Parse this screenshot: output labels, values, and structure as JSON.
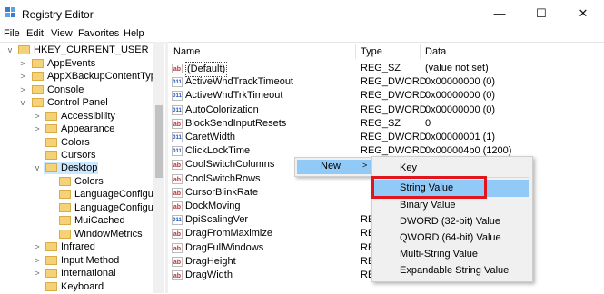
{
  "window": {
    "title": "Registry Editor",
    "minimize": "—",
    "maximize": "☐",
    "close": "✕"
  },
  "menu": [
    "File",
    "Edit",
    "View",
    "Favorites",
    "Help"
  ],
  "tree": [
    {
      "label": "HKEY_CURRENT_USER",
      "expander": "v"
    },
    {
      "label": "AppEvents",
      "expander": ">"
    },
    {
      "label": "AppXBackupContentType",
      "expander": ">"
    },
    {
      "label": "Console",
      "expander": ">"
    },
    {
      "label": "Control Panel",
      "expander": "v"
    },
    {
      "label": "Accessibility",
      "expander": ">"
    },
    {
      "label": "Appearance",
      "expander": ">"
    },
    {
      "label": "Colors",
      "expander": ""
    },
    {
      "label": "Cursors",
      "expander": ""
    },
    {
      "label": "Desktop",
      "expander": "v"
    },
    {
      "label": "Colors",
      "expander": ""
    },
    {
      "label": "LanguageConfigura",
      "expander": ""
    },
    {
      "label": "LanguageConfigura",
      "expander": ""
    },
    {
      "label": "MuiCached",
      "expander": ""
    },
    {
      "label": "WindowMetrics",
      "expander": ""
    },
    {
      "label": "Infrared",
      "expander": ">"
    },
    {
      "label": "Input Method",
      "expander": ">"
    },
    {
      "label": "International",
      "expander": ">"
    },
    {
      "label": "Keyboard",
      "expander": ""
    }
  ],
  "columns": {
    "name": "Name",
    "type": "Type",
    "data": "Data"
  },
  "rows": [
    {
      "icon": "ab",
      "name": "(Default)",
      "type": "REG_SZ",
      "data": "(value not set)"
    },
    {
      "icon": "bin",
      "name": "ActiveWndTrackTimeout",
      "type": "REG_DWORD",
      "data": "0x00000000 (0)"
    },
    {
      "icon": "bin",
      "name": "ActiveWndTrkTimeout",
      "type": "REG_DWORD",
      "data": "0x00000000 (0)"
    },
    {
      "icon": "bin",
      "name": "AutoColorization",
      "type": "REG_DWORD",
      "data": "0x00000000 (0)"
    },
    {
      "icon": "ab",
      "name": "BlockSendInputResets",
      "type": "REG_SZ",
      "data": "0"
    },
    {
      "icon": "bin",
      "name": "CaretWidth",
      "type": "REG_DWORD",
      "data": "0x00000001 (1)"
    },
    {
      "icon": "bin",
      "name": "ClickLockTime",
      "type": "REG_DWORD",
      "data": "0x000004b0 (1200)"
    },
    {
      "icon": "ab",
      "name": "CoolSwitchColumns",
      "type": "",
      "data": ""
    },
    {
      "icon": "ab",
      "name": "CoolSwitchRows",
      "type": "",
      "data": ""
    },
    {
      "icon": "ab",
      "name": "CursorBlinkRate",
      "type": "",
      "data": ""
    },
    {
      "icon": "ab",
      "name": "DockMoving",
      "type": "",
      "data": ""
    },
    {
      "icon": "bin",
      "name": "DpiScalingVer",
      "type": "REG",
      "data": ""
    },
    {
      "icon": "ab",
      "name": "DragFromMaximize",
      "type": "REG",
      "data": ""
    },
    {
      "icon": "ab",
      "name": "DragFullWindows",
      "type": "REG",
      "data": ""
    },
    {
      "icon": "ab",
      "name": "DragHeight",
      "type": "REG",
      "data": ""
    },
    {
      "icon": "ab",
      "name": "DragWidth",
      "type": "REG",
      "data": ""
    }
  ],
  "context_menu": {
    "new_label": "New",
    "new_arrow": ">",
    "submenu": [
      "Key",
      "String Value",
      "Binary Value",
      "DWORD (32-bit) Value",
      "QWORD (64-bit) Value",
      "Multi-String Value",
      "Expandable String Value"
    ]
  },
  "colors": {
    "highlight": "#91c9f7",
    "callout": "#e2141c",
    "folder": "#f5d277"
  }
}
